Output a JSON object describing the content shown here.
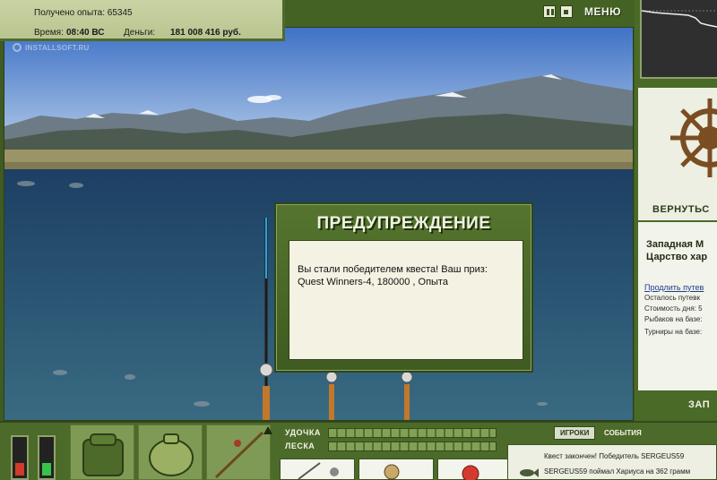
{
  "hud": {
    "experience_label": "Получено опыта:",
    "experience_value": "65345",
    "time_label": "Время:",
    "time_value": "08:40 ВС",
    "money_label": "Деньги:",
    "money_value": "181 008 416 руб."
  },
  "watermark": "INSTALLSOFT.RU",
  "controls": {
    "menu_label": "МЕНЮ",
    "pause_icon": "pause-icon",
    "sound_icon": "sound-icon"
  },
  "right_panel": {
    "return_label": "ВЕРНУТЬС",
    "location_line1": "Западная М",
    "location_line2": "Царство хар",
    "extend_link": "Продлить путев",
    "lines": [
      "Осталось путевк",
      "Стоимость дня: 5",
      "Рыбаков на базе:",
      "Турниры на базе:"
    ],
    "exit_label": "ЗАП"
  },
  "bottom": {
    "rod_label": "УДОЧКА",
    "line_label": "ЛЕСКА",
    "gauge_colors": {
      "left": "#d23b2b",
      "right": "#39c24a"
    },
    "tabs": {
      "players": "ИГРОКИ",
      "events": "СОБЫТИЯ"
    },
    "feed": [
      "Квест закончен! Победитель SERGEUS59",
      "SERGEUS59 поймал Хариуса на 362 грамм"
    ]
  },
  "dialog": {
    "title": "ПРЕДУПРЕЖДЕНИЕ",
    "message": "Вы стали победителем квеста! Ваш приз: Quest Winners-4, 180000 , Опыта"
  },
  "colors": {
    "panel_green": "#4a6a27",
    "panel_light": "#ecefe2",
    "accent_text": "#f1f3e6"
  }
}
